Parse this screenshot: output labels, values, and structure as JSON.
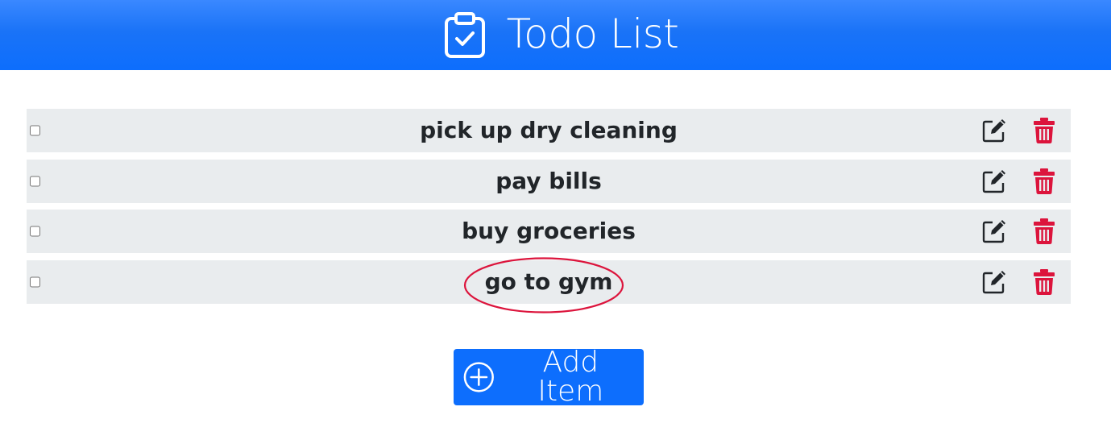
{
  "header": {
    "title": "Todo List",
    "icon": "clipboard-check-icon"
  },
  "todos": [
    {
      "label": "pick up dry cleaning",
      "checked": false
    },
    {
      "label": "pay bills",
      "checked": false
    },
    {
      "label": "buy groceries",
      "checked": false
    },
    {
      "label": "go to gym",
      "checked": false,
      "highlighted": true
    }
  ],
  "row_actions": {
    "edit_icon": "pencil-square-icon",
    "delete_icon": "trash-icon"
  },
  "add_button": {
    "label": "Add Item",
    "icon": "plus-circle-icon"
  },
  "colors": {
    "primary": "#0d6efd",
    "header_top": "#3a88ff",
    "row_bg": "#e9ecee",
    "delete": "#dc143c",
    "annotation": "#dc143c",
    "text": "#212529"
  }
}
